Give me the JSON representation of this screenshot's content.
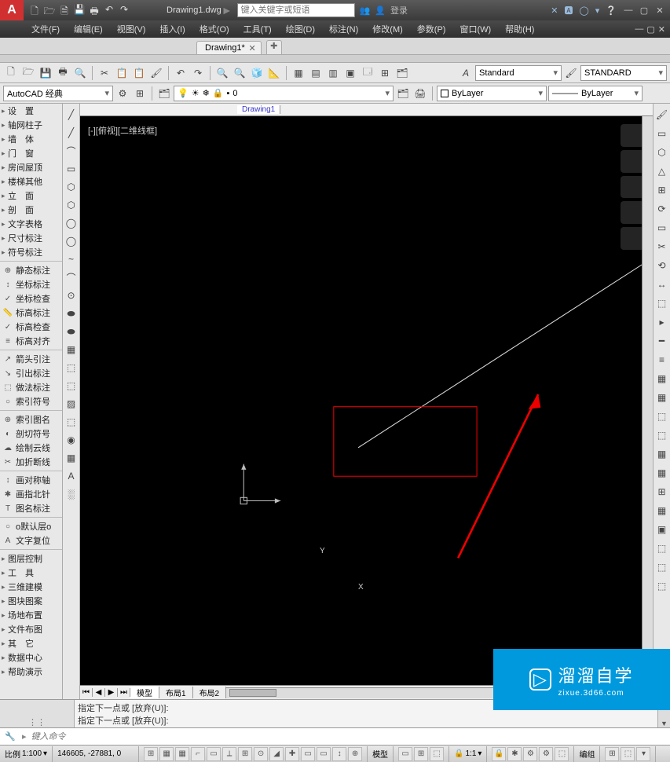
{
  "titlebar": {
    "app_logo": "A",
    "qat": [
      "🗋",
      "🗁",
      "🗎",
      "💾",
      "🖶",
      "↶",
      "↷"
    ],
    "title": "Drawing1.dwg",
    "search_arrow": "►",
    "search_placeholder": "键入关键字或短语",
    "account_icons": [
      "👥",
      "👤"
    ],
    "account_label": "登录",
    "right_icons": [
      "✕",
      "🅰",
      "◯",
      "▾",
      "❔"
    ],
    "win": [
      "—",
      "▢",
      "✕"
    ]
  },
  "menubar": {
    "items": [
      "文件(F)",
      "编辑(E)",
      "视图(V)",
      "插入(I)",
      "格式(O)",
      "工具(T)",
      "绘图(D)",
      "标注(N)",
      "修改(M)",
      "参数(P)",
      "窗口(W)",
      "帮助(H)"
    ],
    "docwin": [
      "—",
      "▢",
      "✕"
    ]
  },
  "doctab": {
    "label": "Drawing1*",
    "close": "✕",
    "new": "✚"
  },
  "toolbar1": {
    "icons": [
      "🗋",
      "🗁",
      "💾",
      "🖶",
      "🔍",
      "✂",
      "📋",
      "📋",
      "↶",
      "↷",
      "🖌",
      "🔍",
      "🔍",
      "🧊",
      "📐",
      "▦",
      "▤",
      "▥",
      "▣",
      "🗔",
      "⊞",
      "🗂"
    ],
    "textstyle_combo": "Standard",
    "dimstyle_combo": "STANDARD",
    "a_icon": "A"
  },
  "toolbar2": {
    "workspace_combo": "AutoCAD 经典",
    "gear": "⚙",
    "layer_icons": [
      "💡",
      "❄",
      "🔒",
      "🖍"
    ],
    "layer_combo": "0",
    "more_icons": [
      "🗂",
      "🖨"
    ],
    "bylayer1": "ByLayer",
    "linetype": "———",
    "bylayer2": "ByLayer"
  },
  "file_tabs": {
    "blank": "",
    "drawing": "Drawing1"
  },
  "leftpanel": {
    "groups": [
      {
        "items": [
          {
            "chev": "▸",
            "label": "设　置"
          },
          {
            "chev": "▸",
            "label": "轴网柱子"
          },
          {
            "chev": "▸",
            "label": "墙　体"
          },
          {
            "chev": "▸",
            "label": "门　窗"
          },
          {
            "chev": "▸",
            "label": "房间屋顶"
          },
          {
            "chev": "▸",
            "label": "楼梯其他"
          },
          {
            "chev": "▸",
            "label": "立　面"
          },
          {
            "chev": "▸",
            "label": "剖　面"
          },
          {
            "chev": "▸",
            "label": "文字表格"
          },
          {
            "chev": "▸",
            "label": "尺寸标注"
          },
          {
            "chev": "▸",
            "label": "符号标注"
          }
        ]
      },
      {
        "items": [
          {
            "ic": "⊕",
            "label": "静态标注"
          },
          {
            "ic": "↕",
            "label": "坐标标注"
          },
          {
            "ic": "✓",
            "label": "坐标检查"
          },
          {
            "ic": "📏",
            "label": "标高标注"
          },
          {
            "ic": "✓",
            "label": "标高检查"
          },
          {
            "ic": "≡",
            "label": "标高对齐"
          }
        ]
      },
      {
        "items": [
          {
            "ic": "↗",
            "label": "箭头引注"
          },
          {
            "ic": "↘",
            "label": "引出标注"
          },
          {
            "ic": "⬚",
            "label": "做法标注"
          },
          {
            "ic": "○",
            "label": "索引符号"
          }
        ]
      },
      {
        "items": [
          {
            "ic": "⊕",
            "label": "索引图名"
          },
          {
            "ic": "◐",
            "label": "剖切符号"
          },
          {
            "ic": "☁",
            "label": "绘制云线"
          },
          {
            "ic": "✂",
            "label": "加折断线"
          }
        ]
      },
      {
        "items": [
          {
            "ic": "↕",
            "label": "画对称轴"
          },
          {
            "ic": "✱",
            "label": "画指北针"
          },
          {
            "ic": "T",
            "label": "图名标注"
          }
        ]
      },
      {
        "items": [
          {
            "ic": "○",
            "label": "o默认层o"
          },
          {
            "ic": "A",
            "label": "文字复位"
          }
        ]
      },
      {
        "items": [
          {
            "chev": "▸",
            "label": "图层控制"
          },
          {
            "chev": "▸",
            "label": "工　具"
          },
          {
            "chev": "▸",
            "label": "三维建模"
          },
          {
            "chev": "▸",
            "label": "图块图案"
          },
          {
            "chev": "▸",
            "label": "场地布置"
          },
          {
            "chev": "▸",
            "label": "文件布图"
          },
          {
            "chev": "▸",
            "label": "其　它"
          },
          {
            "chev": "▸",
            "label": "数据中心"
          },
          {
            "chev": "▸",
            "label": "帮助演示"
          }
        ]
      }
    ]
  },
  "drawtool": [
    "╱",
    "╱",
    "⌒",
    "▭",
    "⬡",
    "⬡",
    "◯",
    "◯",
    "~",
    "⌒",
    "⊙",
    "⬬",
    "⬬",
    "▦",
    "⬚",
    "⬚",
    "▨",
    "⬚",
    "◉",
    "▦",
    "A",
    "░"
  ],
  "righttool": [
    "🖌",
    "▭",
    "⬡",
    "△",
    "⊞",
    "⟳",
    "▭",
    "✂",
    "⟲",
    "↔",
    "⬚",
    "▸",
    "━",
    "≡",
    "▦",
    "▦",
    "⬚",
    "⬚",
    "▦",
    "▦",
    "⊞",
    "▦",
    "▣",
    "⬚",
    "⬚",
    "⬚"
  ],
  "canvas": {
    "vplabel": "[-][俯视][二维线框]",
    "ucs_y": "Y",
    "ucs_x": "X"
  },
  "layout_tabs": {
    "nav": [
      "⏮",
      "◀",
      "▶",
      "⏭"
    ],
    "tabs": [
      "模型",
      "布局1",
      "布局2"
    ]
  },
  "cmd": {
    "line1": "指定下一点或 [放弃(U)]:",
    "line2": "指定下一点或 [放弃(U)]:",
    "icon": "🔧",
    "chev": "▸",
    "placeholder": "键入命令"
  },
  "status": {
    "scale_label": "比例",
    "scale_combo": "1:100",
    "coords": "146605, -27881, 0",
    "icons1": [
      "⊞",
      "▦",
      "▦",
      "⌐",
      "▭",
      "⟂",
      "⊞",
      "⊙",
      "◢",
      "✚",
      "▭",
      "▭",
      "↕",
      "⊕"
    ],
    "model": "模型",
    "icons2": [
      "▭",
      "⊞",
      "⬚"
    ],
    "anno": "1:1",
    "icons3": [
      "🔒",
      "✱",
      "⚙",
      "⚙",
      "⬚"
    ],
    "edit": "编组",
    "icons4": [
      "⊞",
      "⬚",
      "▾"
    ]
  },
  "watermark": {
    "big": "溜溜自学",
    "sub": "zixue.3d66.com",
    "play": "▷"
  }
}
